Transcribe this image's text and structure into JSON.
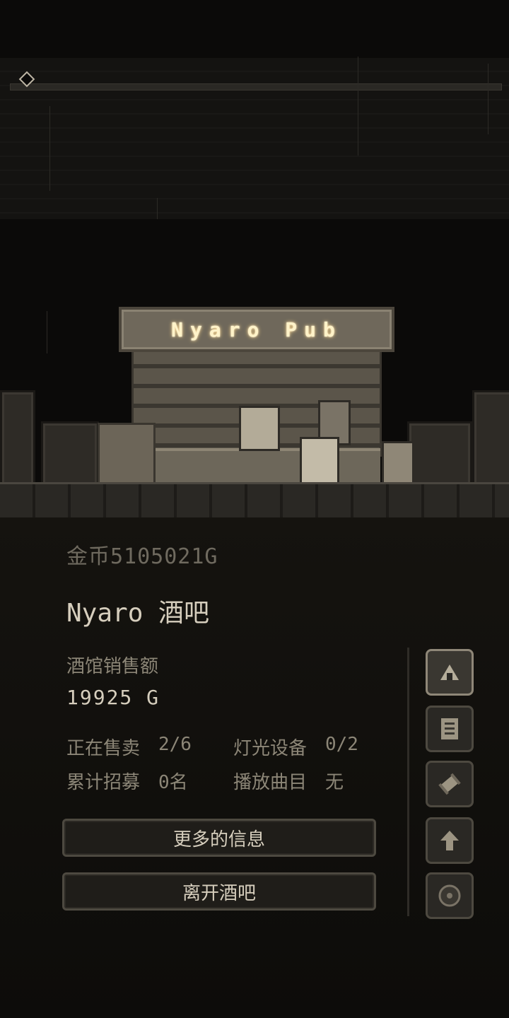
{
  "scene": {
    "sign_text": "Nyaro Pub"
  },
  "panel": {
    "gold": "金币5105021G",
    "title": "Nyaro 酒吧",
    "sales_label": "酒馆销售额",
    "sales_value": "19925 G",
    "stats": {
      "selling_label": "正在售卖",
      "selling_value": "2/6",
      "lighting_label": "灯光设备",
      "lighting_value": "0/2",
      "recruited_label": "累计招募",
      "recruited_value": "0名",
      "music_label": "播放曲目",
      "music_value": "无"
    },
    "buttons": {
      "more_info": "更多的信息",
      "leave": "离开酒吧"
    }
  },
  "side_buttons": [
    {
      "icon": "tent-icon",
      "active": true
    },
    {
      "icon": "document-icon",
      "active": false
    },
    {
      "icon": "scroll-icon",
      "active": false
    },
    {
      "icon": "arrow-up-icon",
      "active": false
    },
    {
      "icon": "disc-icon",
      "active": false
    }
  ],
  "colors": {
    "background": "#0b0a09",
    "sepia_text": "#d6cebd",
    "muted_text": "#8c8677",
    "sign_glow": "#fff3c9"
  }
}
